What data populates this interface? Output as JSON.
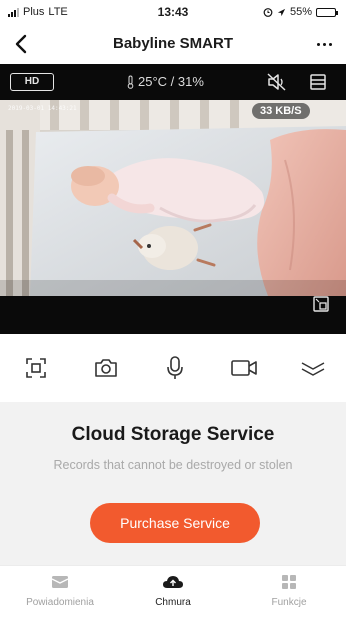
{
  "status_bar": {
    "carrier": "Plus",
    "network": "LTE",
    "time": "13:43",
    "battery": "55%",
    "battery_level": 0.55
  },
  "nav": {
    "title": "Babyline SMART"
  },
  "video": {
    "quality_label": "HD",
    "env_readout": "25°C / 31%",
    "timestamp": "2019-03-01 14:43:21",
    "bitrate": "33 KB/S"
  },
  "controls": {
    "icons": [
      "screen-record-icon",
      "camera-icon",
      "microphone-icon",
      "video-camera-icon",
      "collapse-chevron-icon"
    ]
  },
  "cloud": {
    "title": "Cloud Storage Service",
    "subtitle": "Records that cannot be destroyed or stolen",
    "purchase_label": "Purchase Service",
    "accent": "#f25a2e"
  },
  "tabs": [
    {
      "label": "Powiadomienia",
      "icon": "message-icon"
    },
    {
      "label": "Chmura",
      "icon": "cloud-icon"
    },
    {
      "label": "Funkcje",
      "icon": "grid-icon"
    }
  ]
}
